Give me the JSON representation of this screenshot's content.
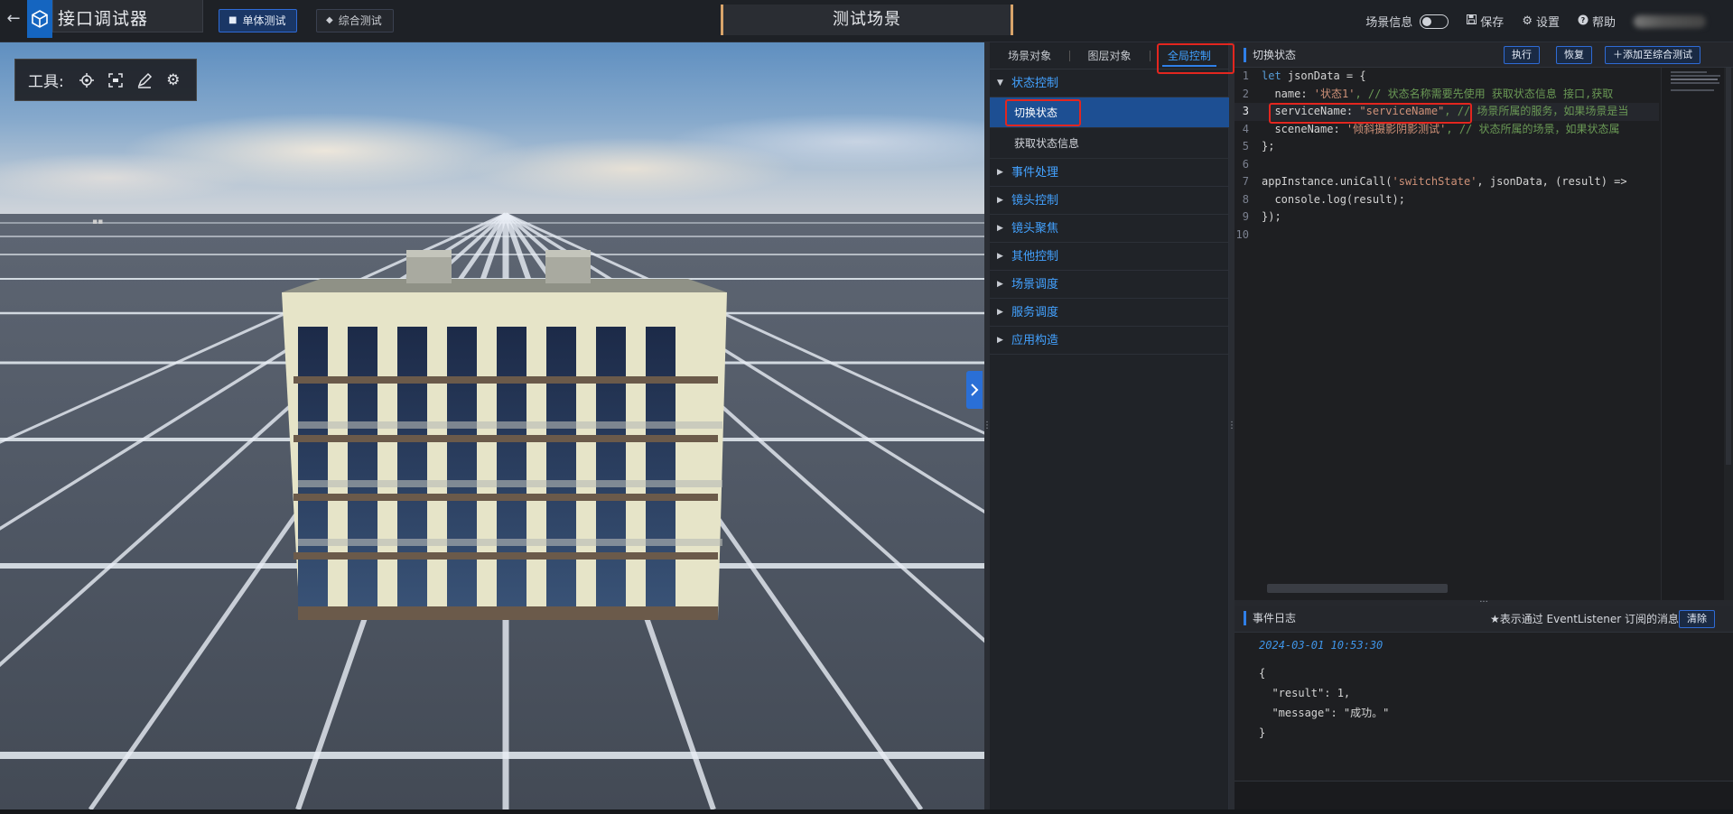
{
  "header": {
    "app_title": "接口调试器",
    "tabs": [
      {
        "label": "单体测试",
        "active": true
      },
      {
        "label": "综合测试",
        "active": false
      }
    ],
    "scene_title": "测试场景",
    "scene_info_label": "场景信息",
    "save_label": "保存",
    "settings_label": "设置",
    "help_label": "帮助"
  },
  "viewport": {
    "toolbox_label": "工具:",
    "tools": [
      "locate-icon",
      "frame-icon",
      "pen-icon",
      "gear-settings-icon"
    ]
  },
  "tree": {
    "tabs": [
      {
        "label": "场景对象",
        "active": false
      },
      {
        "label": "图层对象",
        "active": false
      },
      {
        "label": "全局控制",
        "active": true
      }
    ],
    "groups": [
      {
        "label": "状态控制",
        "expanded": true,
        "children": [
          "切换状态",
          "获取状态信息"
        ]
      },
      {
        "label": "事件处理"
      },
      {
        "label": "镜头控制"
      },
      {
        "label": "镜头聚焦"
      },
      {
        "label": "其他控制"
      },
      {
        "label": "场景调度"
      },
      {
        "label": "服务调度"
      },
      {
        "label": "应用构造"
      }
    ]
  },
  "code_panel": {
    "title": "切换状态",
    "run_label": "执行",
    "restore_label": "恢复",
    "add_label": "添加至综合测试",
    "line_numbers": [
      "1",
      "2",
      "3",
      "4",
      "5",
      "6",
      "7",
      "8",
      "9",
      "10"
    ],
    "code": {
      "l1_kw": "let",
      "l1_rest": " jsonData = {",
      "l2_key": "  name: ",
      "l2_str": "'状态1'",
      "l2_cmt": ", // 状态名称需要先使用 获取状态信息 接口,获取",
      "l3_key": "  serviceName: ",
      "l3_str": "\"serviceName\"",
      "l3_cmt": ", // 场景所属的服务，如果场景是当",
      "l4_key": "  sceneName: ",
      "l4_str": "'倾斜摄影阴影测试'",
      "l4_cmt": ", // 状态所属的场景，如果状态属",
      "l5": "};",
      "l7_pre": "appInstance.uniCall(",
      "l7_str": "'switchState'",
      "l7_post": ", jsonData, (result) =>",
      "l8": "  console.log(result);",
      "l9": "});"
    }
  },
  "log_panel": {
    "title": "事件日志",
    "hint": "★表示通过 EventListener 订阅的消息",
    "clear_label": "清除",
    "timestamp": "2024-03-01 10:53:30",
    "json_text": "{\n  \"result\": 1,\n  \"message\": \"成功。\"\n}"
  },
  "colors": {
    "accent": "#2f7fe8",
    "tree_link": "#43a2ff",
    "highlight": "#e3261f",
    "panel_bg": "#202328"
  }
}
